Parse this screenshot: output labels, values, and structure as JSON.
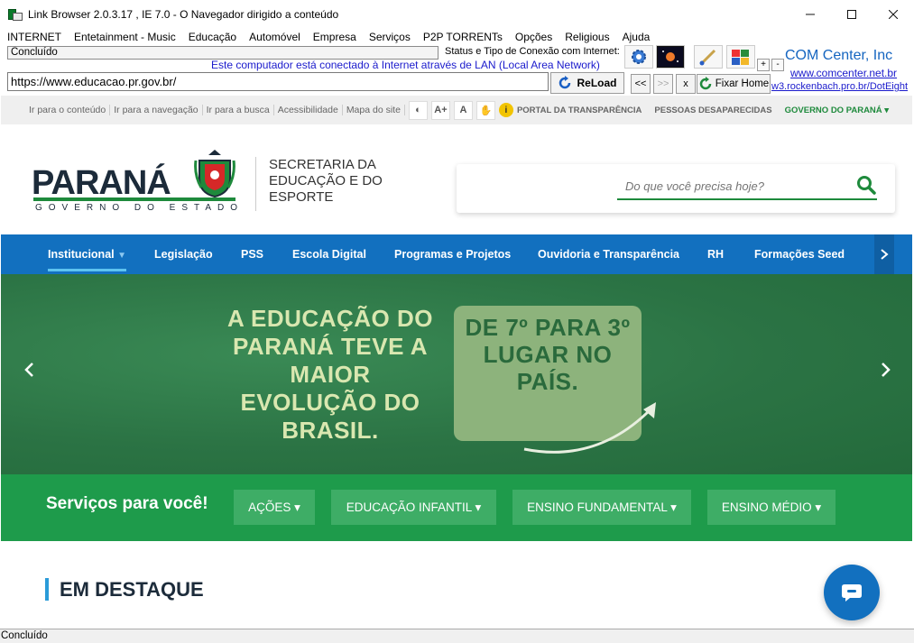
{
  "window": {
    "title": "Link Browser  2.0.3.17  ,  IE 7.0 - O Navegador dirigido a conteúdo"
  },
  "menu": [
    "INTERNET",
    "Entetainment - Music",
    "Educação",
    "Automóvel",
    "Empresa",
    "Serviços",
    "P2P TORRENTs",
    "Opções",
    "Religious",
    "Ajuda"
  ],
  "toolbar": {
    "status": "Concluído",
    "conn_title": "Status e Tipo de Conexão com Internet:",
    "conn_text": "Este computador está conectado à Internet através de LAN (Local Area Network)",
    "url": "https://www.educacao.pr.gov.br/",
    "reload_label": "ReLoad",
    "back_label": "<<",
    "forward_label": ">>",
    "stop_label": "x",
    "fixhome_label": "Fixar Home",
    "plus_label": "+",
    "minus_label": "-"
  },
  "brand": {
    "name": "COM Center, Inc",
    "url1": "www.comcenter.net.br",
    "url2": "w3.rockenbach.pro.br/DotEight"
  },
  "page": {
    "accessibility_links": [
      "Ir para o conteúdo",
      "Ir para a navegação",
      "Ir para a busca",
      "Acessibilidade",
      "Mapa do site"
    ],
    "acc_aplus": "A+",
    "acc_a": "A",
    "gov_links": [
      "PORTAL DA TRANSPARÊNCIA",
      "PESSOAS DESAPARECIDAS",
      "GOVERNO DO PARANÁ"
    ],
    "logo_main": "PARANÁ",
    "logo_sub": "GOVERNO DO ESTADO",
    "secretaria": "SECRETARIA DA EDUCAÇÃO E DO ESPORTE",
    "search_placeholder": "Do que você precisa hoje?",
    "nav": [
      "Institucional",
      "Legislação",
      "PSS",
      "Escola Digital",
      "Programas e Projetos",
      "Ouvidoria e Transparência",
      "RH",
      "Formações Seed"
    ],
    "banner_text": "A EDUCAÇÃO DO PARANÁ TEVE A MAIOR EVOLUÇÃO DO BRASIL.",
    "banner_card": "DE 7º PARA 3º LUGAR NO PAÍS.",
    "services_title": "Serviços para você!",
    "services": [
      "AÇÕES",
      "EDUCAÇÃO INFANTIL",
      "ENSINO FUNDAMENTAL",
      "ENSINO MÉDIO"
    ],
    "destaque": "EM DESTAQUE"
  },
  "statusbar": "Concluído",
  "colors": {
    "nav_blue": "#1270bf",
    "gov_green": "#1e8a3c",
    "services_green": "#1e9b4b",
    "banner_green": "#2d7a48"
  }
}
